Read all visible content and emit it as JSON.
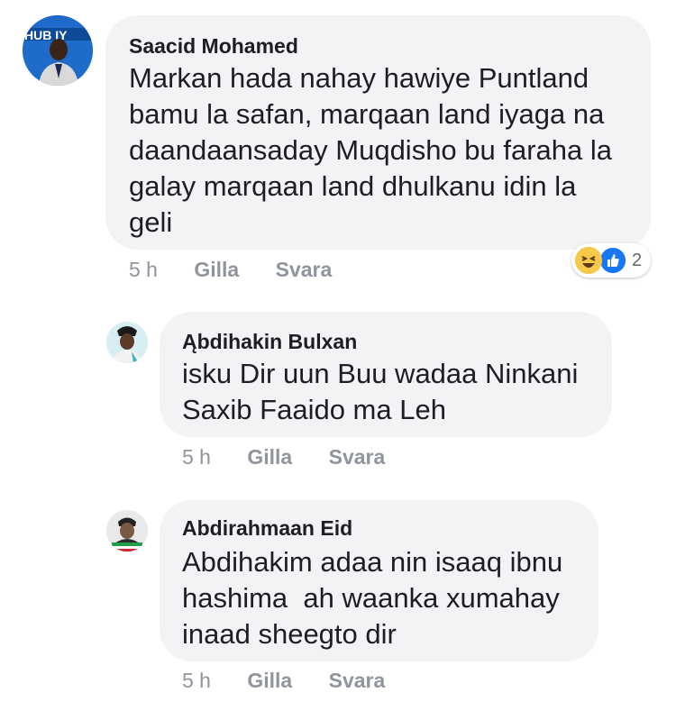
{
  "comments": [
    {
      "author": "Saacid Mohamed",
      "text": "Markan hada nahay hawiye Puntland\nbamu la safan, marqaan land iyaga na\ndaandaansaday Muqdisho bu faraha la\ngalay marqaan land dhulkanu idin la\ngeli",
      "avatar_text": "HUB  IY",
      "time": "5 h",
      "like_label": "Gilla",
      "reply_label": "Svara",
      "reactions": {
        "icons": [
          "haha-icon",
          "like-icon"
        ],
        "count": "2"
      }
    },
    {
      "author": "Ąbdihakin Bulxan",
      "text": "isku Dir uun Buu wadaa Ninkani\nSaxib Faaido ma Leh",
      "time": "5 h",
      "like_label": "Gilla",
      "reply_label": "Svara"
    },
    {
      "author": "Abdirahmaan Eid",
      "text": "Abdihakim adaa nin isaaq ibnu\nhashima  ah waanka xumahay\ninaad sheegto dir",
      "time": "5 h",
      "like_label": "Gilla",
      "reply_label": "Svara"
    }
  ],
  "colors": {
    "bubble": "#f2f3f5",
    "like_blue": "#1877f2",
    "haha_yellow": "#f7c94b",
    "meta_gray": "#90949c"
  }
}
